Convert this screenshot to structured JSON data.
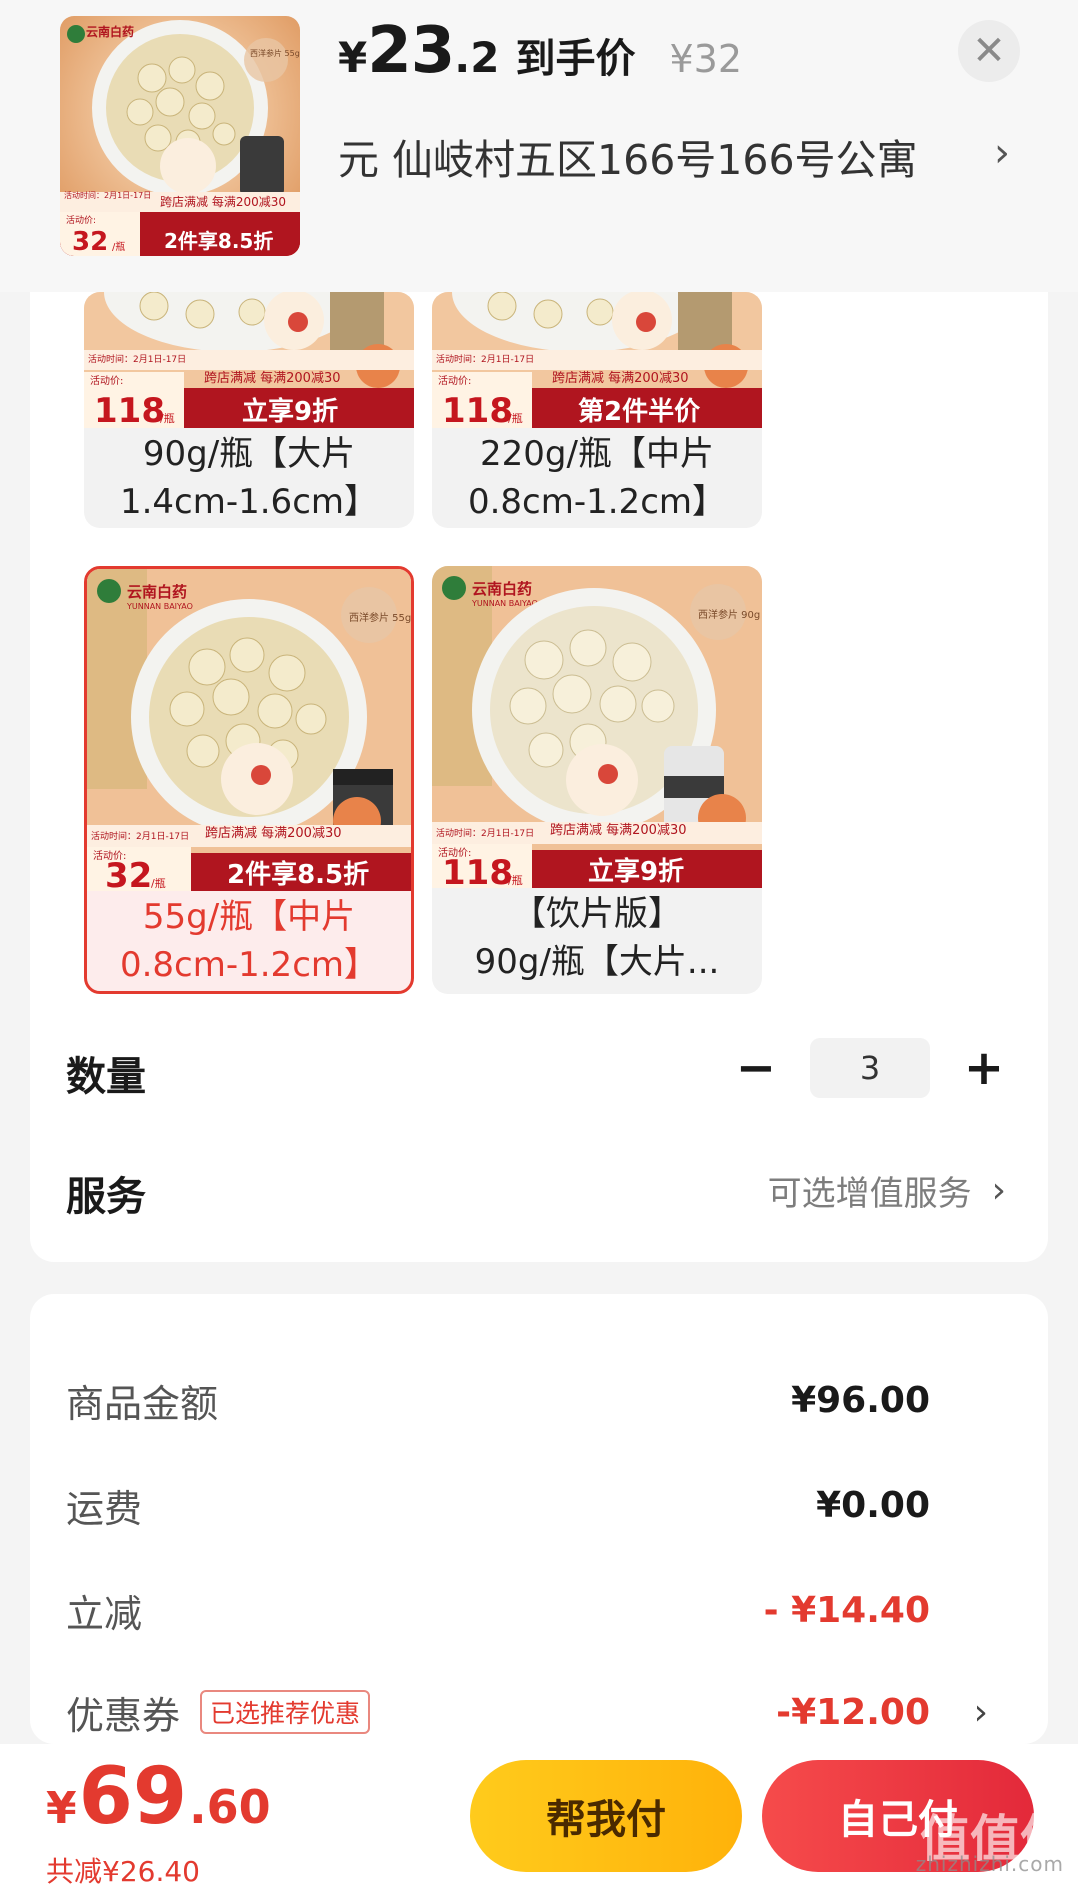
{
  "header": {
    "currency": "¥",
    "price_int": "23",
    "price_dec": ".2",
    "price_label": "到手价",
    "original_price": "¥32",
    "close_icon": "close-icon",
    "address": "元  仙岐村五区166号166号公寓",
    "thumb": {
      "brand": "云南白药",
      "brand_en": "YUNNAN BAIYAO",
      "badge": "西洋参片 55g",
      "promo": "跨店满减 每满200减30",
      "promo_date": "活动时间：2月1日-17日",
      "activity_label": "活动价:",
      "price": "32",
      "unit": "/瓶",
      "deal": "2件享8.5折"
    }
  },
  "sku_options": [
    {
      "price": "118",
      "unit": "/瓶",
      "deal": "立享9折",
      "promo": "跨店满减 每满200减30",
      "promo_date": "活动时间：2月1日-17日",
      "activity_label": "活动价:",
      "name_line1": "90g/瓶【大片",
      "name_line2": "1.4cm-1.6cm】",
      "selected": false
    },
    {
      "price": "118",
      "unit": "/瓶",
      "deal": "第2件半价",
      "promo": "跨店满减 每满200减30",
      "promo_date": "活动时间：2月1日-17日",
      "activity_label": "活动价:",
      "name_line1": "220g/瓶【中片",
      "name_line2": "0.8cm-1.2cm】",
      "selected": false
    },
    {
      "price": "32",
      "unit": "/瓶",
      "deal": "2件享8.5折",
      "promo": "跨店满减 每满200减30",
      "promo_date": "活动时间：2月1日-17日",
      "activity_label": "活动价:",
      "brand": "云南白药",
      "brand_en": "YUNNAN BAIYAO",
      "badge": "西洋参片 55g",
      "name_line1": "55g/瓶【中片",
      "name_line2": "0.8cm-1.2cm】",
      "selected": true
    },
    {
      "price": "118",
      "unit": "/瓶",
      "deal": "立享9折",
      "promo": "跨店满减 每满200减30",
      "promo_date": "活动时间：2月1日-17日",
      "activity_label": "活动价:",
      "brand": "云南白药",
      "brand_en": "YUNNAN BAIYAO",
      "badge": "西洋参片 90g",
      "name_line1": "【饮片版】",
      "name_line2": "90g/瓶【大片...",
      "selected": false
    }
  ],
  "quantity": {
    "label": "数量",
    "minus": "−",
    "value": "3",
    "plus": "+"
  },
  "service": {
    "label": "服务",
    "value": "可选增值服务",
    "chevron": "›"
  },
  "summary": {
    "goods_label": "商品金额",
    "goods_value": "¥96.00",
    "shipping_label": "运费",
    "shipping_value": "¥0.00",
    "discount_label": "立减",
    "discount_value": "- ¥14.40",
    "coupon_label": "优惠券",
    "coupon_tag": "已选推荐优惠",
    "coupon_value": "-¥12.00",
    "chevron": "›"
  },
  "footer": {
    "currency": "¥",
    "total_int": "69",
    "total_dec": ".60",
    "saving": "共减¥26.40",
    "help_pay": "帮我付",
    "self_pay": "自己付"
  },
  "watermark": {
    "text": "zhizhizhi.com",
    "big": "值值值"
  },
  "colors": {
    "accent_red": "#e33a2f",
    "help_button": "#ffc012",
    "pay_button": "#ee3a42",
    "promo_banner": "#b0151f"
  }
}
